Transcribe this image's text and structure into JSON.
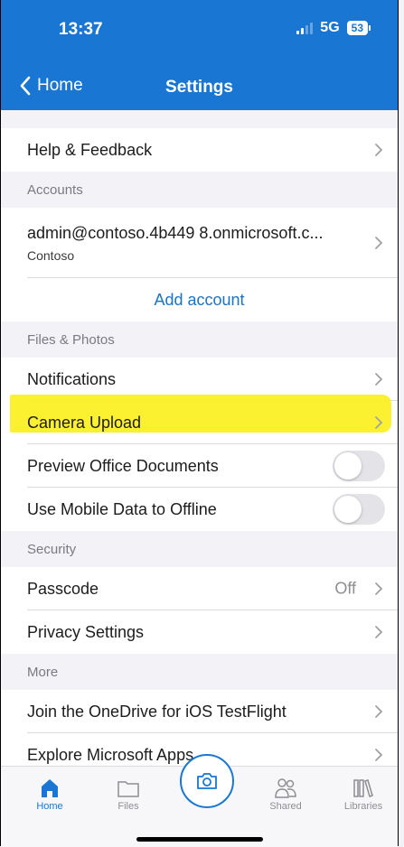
{
  "status": {
    "time": "13:37",
    "network": "5G",
    "battery": "53"
  },
  "nav": {
    "back_label": "Home",
    "title": "Settings"
  },
  "rows": {
    "help": "Help & Feedback",
    "accounts_header": "Accounts",
    "account_email": "admin@contoso.4b449 8.onmicrosoft.c...",
    "account_org": "Contoso",
    "add_account": "Add account",
    "files_header": "Files & Photos",
    "notifications": "Notifications",
    "camera_upload": "Camera Upload",
    "preview_office": "Preview Office Documents",
    "mobile_data": "Use Mobile Data to Offline",
    "security_header": "Security",
    "passcode": "Passcode",
    "passcode_value": "Off",
    "privacy": "Privacy Settings",
    "more_header": "More",
    "testflight": "Join the OneDrive for iOS TestFlight",
    "explore": "Explore Microsoft Apps"
  },
  "tabs": {
    "home": "Home",
    "files": "Files",
    "shared": "Shared",
    "libraries": "Libraries"
  },
  "colors": {
    "accent": "#1976d2",
    "highlight": "#fcef1b"
  }
}
